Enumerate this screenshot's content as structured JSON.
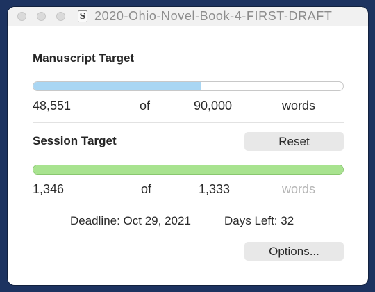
{
  "window": {
    "title": "2020-Ohio-Novel-Book-4-FIRST-DRAFT",
    "doc_icon_glyph": "S"
  },
  "manuscript": {
    "heading": "Manuscript Target",
    "current": "48,551",
    "of_label": "of",
    "target": "90,000",
    "unit": "words",
    "progress_fraction": 0.5394,
    "fill_color": "#a9d6f3"
  },
  "session": {
    "heading": "Session Target",
    "reset_label": "Reset",
    "current": "1,346",
    "of_label": "of",
    "target": "1,333",
    "unit": "words",
    "progress_fraction": 1.0,
    "fill_color": "#a8e38f"
  },
  "deadline": {
    "text": "Deadline: Oct 29, 2021",
    "days_left": "Days Left: 32"
  },
  "options_label": "Options..."
}
